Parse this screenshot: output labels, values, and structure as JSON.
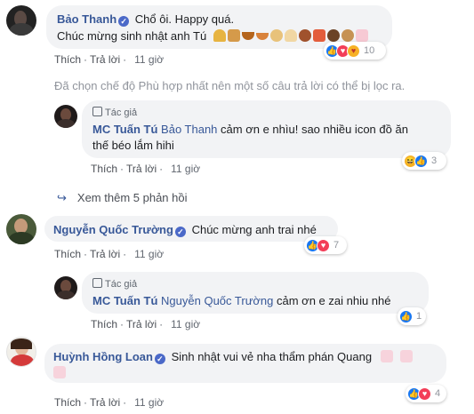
{
  "colors": {
    "link": "#385898",
    "bubble": "#f2f3f5",
    "like": "#1877f2",
    "love": "#f33e58"
  },
  "comments": [
    {
      "author": "Bảo Thanh",
      "text_line1": "Chổ ôi. Happy quá.",
      "text_line2": "Chúc mừng sinh nhật anh Tú",
      "emojis": [
        "taco",
        "bread",
        "curry",
        "tea",
        "fortune-cookie",
        "dumpling",
        "meat",
        "sushi",
        "coconut",
        "cookie",
        "cake"
      ],
      "like": "Thích",
      "reply": "Trả lời",
      "time": "11 giờ",
      "reaction_count": "10",
      "reactions": [
        "like",
        "love",
        "care"
      ]
    },
    {
      "author": "Nguyễn Quốc Trường",
      "text": "Chúc mừng anh trai nhé",
      "like": "Thích",
      "reply": "Trả lời",
      "time": "11 giờ",
      "reaction_count": "7",
      "reactions": [
        "like",
        "love"
      ]
    },
    {
      "author": "Huỳnh Hồng Loan",
      "text": "Sinh nhật vui vẻ nha thẩm phán Quang",
      "emojis": [
        "cake",
        "cake",
        "cake"
      ],
      "like": "Thích",
      "reply": "Trả lời",
      "time": "11 giờ",
      "reaction_count": "4",
      "reactions": [
        "like",
        "love"
      ]
    }
  ],
  "filter_notice": "Đã chọn chế độ Phù hợp nhất nên một số câu trả lời có thể bị lọc ra.",
  "replies": [
    {
      "author_tag": "Tác giả",
      "author": "MC Tuấn Tú",
      "mention": "Bảo Thanh",
      "text_line1": " cảm ơn e nhìu! sao nhiều icon đồ ăn",
      "text_line2": "thế béo lắm hihi",
      "like": "Thích",
      "reply": "Trả lời",
      "time": "11 giờ",
      "reaction_count": "3",
      "reactions": [
        "haha",
        "like"
      ]
    },
    {
      "author_tag": "Tác giả",
      "author": "MC Tuấn Tú",
      "mention": "Nguyễn Quốc Trường",
      "text_line1": " cảm ơn e zai nhiu nhé",
      "like": "Thích",
      "reply": "Trả lời",
      "time": "11 giờ",
      "reaction_count": "1",
      "reactions": [
        "like"
      ]
    }
  ],
  "view_more": "Xem thêm 5 phản hồi"
}
